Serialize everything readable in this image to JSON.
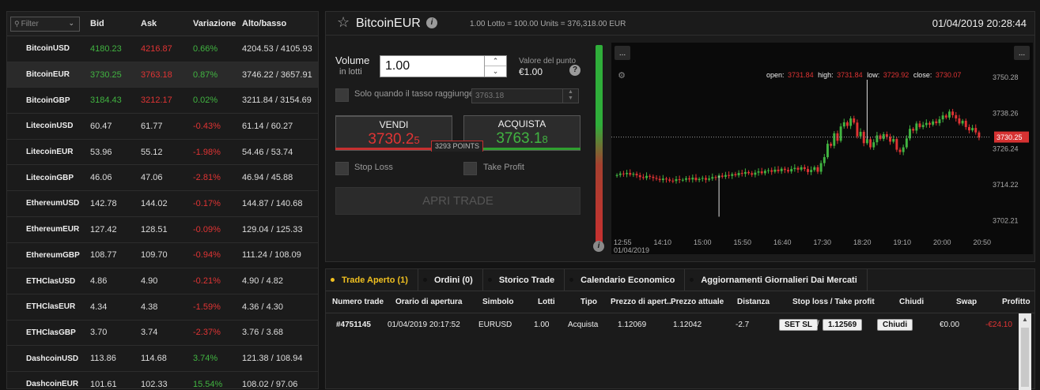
{
  "quotes": {
    "filter_placeholder": "Filter",
    "headers": {
      "bid": "Bid",
      "ask": "Ask",
      "change": "Variazione",
      "range": "Alto/basso"
    },
    "rows": [
      {
        "name": "BitcoinUSD",
        "bid": "4180.23",
        "ask": "4216.87",
        "change": "0.66%",
        "range": "4204.53 / 4105.93",
        "bid_color": "green",
        "ask_color": "red",
        "change_color": "green"
      },
      {
        "name": "BitcoinEUR",
        "bid": "3730.25",
        "ask": "3763.18",
        "change": "0.87%",
        "range": "3746.22 / 3657.91",
        "bid_color": "green",
        "ask_color": "red",
        "change_color": "green",
        "selected": true
      },
      {
        "name": "BitcoinGBP",
        "bid": "3184.43",
        "ask": "3212.17",
        "change": "0.02%",
        "range": "3211.84 / 3154.69",
        "bid_color": "green",
        "ask_color": "red",
        "change_color": "green"
      },
      {
        "name": "LitecoinUSD",
        "bid": "60.47",
        "ask": "61.77",
        "change": "-0.43%",
        "range": "61.14 / 60.27",
        "bid_color": "white",
        "ask_color": "white",
        "change_color": "red"
      },
      {
        "name": "LitecoinEUR",
        "bid": "53.96",
        "ask": "55.12",
        "change": "-1.98%",
        "range": "54.46 / 53.74",
        "bid_color": "white",
        "ask_color": "white",
        "change_color": "red"
      },
      {
        "name": "LitecoinGBP",
        "bid": "46.06",
        "ask": "47.06",
        "change": "-2.81%",
        "range": "46.94 / 45.88",
        "bid_color": "white",
        "ask_color": "white",
        "change_color": "red"
      },
      {
        "name": "EthereumUSD",
        "bid": "142.78",
        "ask": "144.02",
        "change": "-0.17%",
        "range": "144.87 / 140.68",
        "bid_color": "white",
        "ask_color": "white",
        "change_color": "red"
      },
      {
        "name": "EthereumEUR",
        "bid": "127.42",
        "ask": "128.51",
        "change": "-0.09%",
        "range": "129.04 / 125.33",
        "bid_color": "white",
        "ask_color": "white",
        "change_color": "red"
      },
      {
        "name": "EthereumGBP",
        "bid": "108.77",
        "ask": "109.70",
        "change": "-0.94%",
        "range": "111.24 / 108.09",
        "bid_color": "white",
        "ask_color": "white",
        "change_color": "red"
      },
      {
        "name": "ETHClasUSD",
        "bid": "4.86",
        "ask": "4.90",
        "change": "-0.21%",
        "range": "4.90 / 4.82",
        "bid_color": "white",
        "ask_color": "white",
        "change_color": "red"
      },
      {
        "name": "ETHClasEUR",
        "bid": "4.34",
        "ask": "4.38",
        "change": "-1.59%",
        "range": "4.36 / 4.30",
        "bid_color": "white",
        "ask_color": "white",
        "change_color": "red"
      },
      {
        "name": "ETHClasGBP",
        "bid": "3.70",
        "ask": "3.74",
        "change": "-2.37%",
        "range": "3.76 / 3.68",
        "bid_color": "white",
        "ask_color": "white",
        "change_color": "red"
      },
      {
        "name": "DashcoinUSD",
        "bid": "113.86",
        "ask": "114.68",
        "change": "3.74%",
        "range": "121.38 / 108.94",
        "bid_color": "white",
        "ask_color": "white",
        "change_color": "green"
      },
      {
        "name": "DashcoinEUR",
        "bid": "101.61",
        "ask": "102.33",
        "change": "15.54%",
        "range": "108.02 / 97.06",
        "bid_color": "white",
        "ask_color": "white",
        "change_color": "green"
      }
    ]
  },
  "trade": {
    "symbol": "BitcoinEUR",
    "lot_info": "1.00 Lotto = 100.00 Units = 376,318.00 EUR",
    "datetime": "01/04/2019 20:28:44",
    "volume_label": "Volume",
    "volume_sub": "in lotti",
    "volume_value": "1.00",
    "point_value_label": "Valore del punto",
    "point_value": "€1.00",
    "limit_label": "Solo quando il tasso raggiunge",
    "limit_value": "3763.18",
    "sell_label": "VENDI",
    "sell_price_main": "3730.2",
    "sell_price_sub": "5",
    "buy_label": "ACQUISTA",
    "buy_price_main": "3763.1",
    "buy_price_sub": "8",
    "spread_points": "3293 POINTS",
    "stop_loss_label": "Stop Loss",
    "take_profit_label": "Take Profit",
    "open_trade_label": "APRI TRADE",
    "sentiment_buy_fraction": 0.5
  },
  "chart_data": {
    "type": "candlestick",
    "ohlc_text": {
      "open_label": "open:",
      "open": "3731.84",
      "high_label": "high:",
      "high": "3731.84",
      "low_label": "low:",
      "low": "3729.92",
      "close_label": "close:",
      "close": "3730.07"
    },
    "current_price": "3730.25",
    "y_ticks": [
      "3750.28",
      "3738.26",
      "3726.24",
      "3714.22",
      "3702.21"
    ],
    "y_tick_values": [
      3750.28,
      3738.26,
      3726.24,
      3714.22,
      3702.21
    ],
    "ylim": [
      3697,
      3754
    ],
    "x_ticks": [
      "12:55",
      "14:10",
      "15:00",
      "15:50",
      "16:40",
      "17:30",
      "18:20",
      "19:10",
      "20:00",
      "20:50"
    ],
    "x_date": "01/04/2019",
    "menu_label": "...",
    "closes": [
      3717.5,
      3718,
      3717.8,
      3718.2,
      3717.6,
      3717.9,
      3717.4,
      3716.8,
      3716.5,
      3717.2,
      3716.9,
      3716.5,
      3716.2,
      3715.8,
      3716.3,
      3716.0,
      3715.6,
      3715.5,
      3716.1,
      3715.8,
      3715.9,
      3716.4,
      3716.0,
      3716.6,
      3715.8,
      3716.2,
      3716.5,
      3715.9,
      3716.3,
      3716.8,
      3716.6,
      3717.3,
      3716.9,
      3717.5,
      3717.2,
      3717.8,
      3717.4,
      3718.2,
      3717.9,
      3718.5,
      3718.1,
      3717.6,
      3718.3,
      3718.7,
      3718.1,
      3718.9,
      3719.1,
      3718.6,
      3719.3,
      3718.8,
      3719.6,
      3719.2,
      3718.7,
      3719.5,
      3719.9,
      3719.3,
      3720.1,
      3719.5,
      3718.5,
      3719.2,
      3720.1,
      3718.6,
      3721.5,
      3723.5,
      3728.0,
      3727.3,
      3731.5,
      3729.0,
      3733.8,
      3735.2,
      3734.0,
      3736.5,
      3735.1,
      3730.5,
      3732.0,
      3728.2,
      3729.5,
      3726.8,
      3728.5,
      3730.8,
      3729.6,
      3731.2,
      3730.3,
      3728.7,
      3729.6,
      3726.0,
      3725.2,
      3726.8,
      3729.8,
      3733.0,
      3732.4,
      3734.8,
      3733.6,
      3734.3,
      3735.0,
      3734.4,
      3735.5,
      3734.9,
      3736.2,
      3737.5,
      3736.8,
      3738.8,
      3737.6,
      3736.5,
      3734.8,
      3735.7,
      3733.6,
      3732.5,
      3733.3,
      3731.8,
      3730.07
    ]
  },
  "orders": {
    "tabs": [
      "Trade Aperto (1)",
      "Ordini (0)",
      "Storico Trade",
      "Calendario Economico",
      "Aggiornamenti Giornalieri Dai Mercati"
    ],
    "columns": [
      "Numero trade",
      "Orario di apertura",
      "Simbolo",
      "Lotti",
      "Tipo",
      "Prezzo di apert...",
      "Prezzo attuale",
      "Distanza",
      "Stop loss / Take profit",
      "Chiudi",
      "Swap",
      "Profitto"
    ],
    "row": {
      "number": "#4751145",
      "open_time": "01/04/2019 20:17:52",
      "symbol": "EURUSD",
      "lots": "1.00",
      "type": "Acquista",
      "open_price": "1.12069",
      "current_price": "1.12042",
      "distance": "-2.7",
      "set_sl": "SET SL",
      "separator": "/",
      "tp": "1.12569",
      "close": "Chiudi",
      "swap": "€0.00",
      "profit": "-€24.10"
    }
  },
  "colors": {
    "green": "#41b441",
    "red": "#e03434",
    "accent": "#f0c020"
  }
}
